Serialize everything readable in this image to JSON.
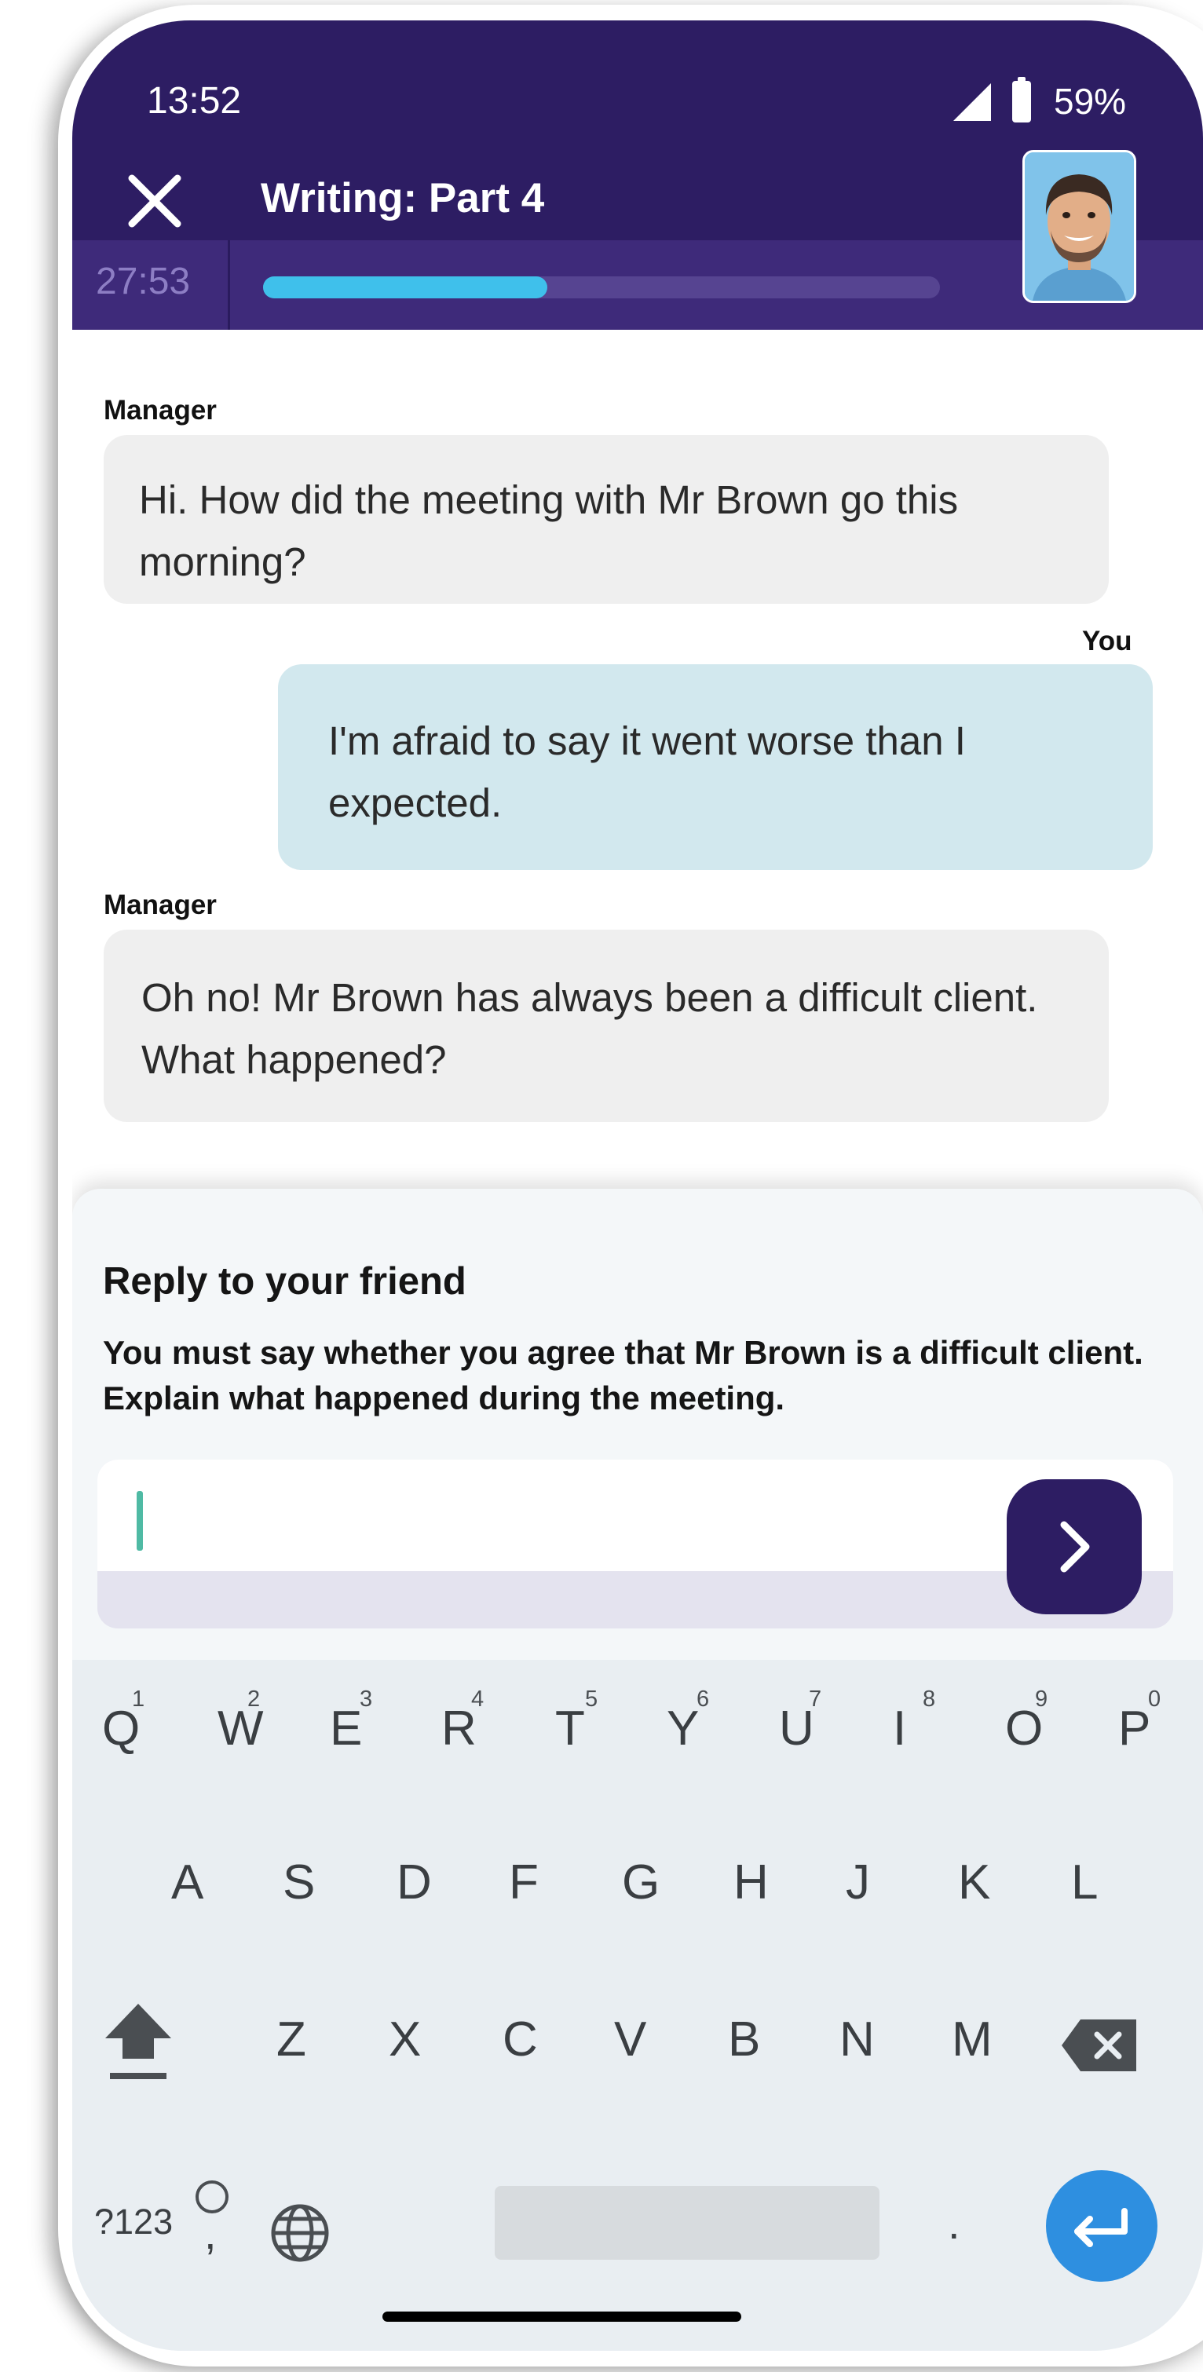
{
  "status_bar": {
    "time": "13:52",
    "battery": "59%"
  },
  "header": {
    "title": "Writing: Part 4",
    "timer": "27:53",
    "progress": 0.42
  },
  "chat": {
    "messages": [
      {
        "sender": "Manager",
        "text": "Hi. How did the meeting with Mr Brown go this morning?"
      },
      {
        "sender": "You",
        "text": "I'm afraid to say it went worse than I expected."
      },
      {
        "sender": "Manager",
        "text": "Oh no! Mr Brown has always been a difficult client. What happened?"
      }
    ]
  },
  "reply": {
    "heading": "Reply to your friend",
    "instruction": "You must say whether you agree that Mr Brown is a difficult client. Explain what happened during the meeting.",
    "input_value": ""
  },
  "keyboard": {
    "row1": [
      "Q",
      "W",
      "E",
      "R",
      "T",
      "Y",
      "U",
      "I",
      "O",
      "P"
    ],
    "row1_hints": [
      "1",
      "2",
      "3",
      "4",
      "5",
      "6",
      "7",
      "8",
      "9",
      "0"
    ],
    "row2": [
      "A",
      "S",
      "D",
      "F",
      "G",
      "H",
      "J",
      "K",
      "L"
    ],
    "row3": [
      "Z",
      "X",
      "C",
      "V",
      "B",
      "N",
      "M"
    ],
    "symbols_label": "?123",
    "comma_label": ",",
    "period_label": "."
  },
  "icons": {
    "close": "close-icon",
    "send": "chevron-right-icon",
    "shift": "shift-icon",
    "backspace": "backspace-icon",
    "globe": "globe-icon",
    "enter": "enter-icon",
    "voice": "microphone-icon"
  },
  "colors": {
    "header": "#2d1d63",
    "progress": "#3fc0eb",
    "accent_enter": "#2e8fe0",
    "outgoing_bubble": "#d2e8ee"
  }
}
